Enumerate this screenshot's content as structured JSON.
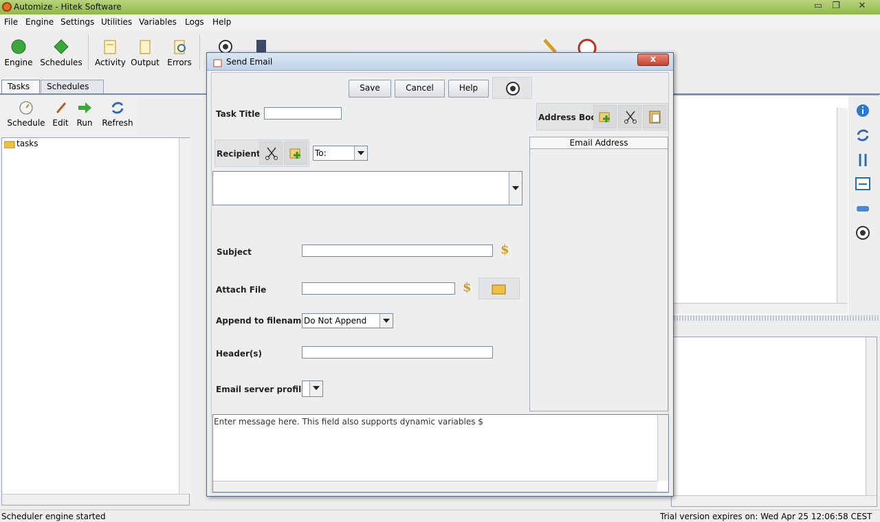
{
  "window": {
    "title": "Automize   - Hitek Software",
    "minimize": "▭",
    "restore": "❐",
    "close": "✕"
  },
  "menu": [
    "File",
    "Engine",
    "Settings",
    "Utilities",
    "Variables",
    "Logs",
    "Help"
  ],
  "toolbar": {
    "engine": "Engine",
    "schedules": "Schedules",
    "activity": "Activity",
    "output": "Output",
    "errors": "Errors"
  },
  "tabs": [
    "Tasks",
    "Schedules"
  ],
  "subtoolbar": {
    "schedule": "Schedule",
    "edit": "Edit",
    "run": "Run",
    "refresh": "Refresh"
  },
  "tree": {
    "root": "tasks"
  },
  "status": {
    "left": "Scheduler engine started",
    "right": "Trial version expires on: Wed Apr 25 12:06:58 CEST 2012"
  },
  "dialog": {
    "title": "Send Email",
    "close": "x",
    "buttons": {
      "save": "Save",
      "cancel": "Cancel",
      "help": "Help"
    },
    "task_title_label": "Task Title",
    "task_title_value": "",
    "address_book_label": "Address Book",
    "recipients_label": "Recipients",
    "recipient_type": "To:",
    "email_address_header": "Email Address",
    "subject_label": "Subject",
    "subject_value": "",
    "attach_label": "Attach File",
    "attach_value": "",
    "append_label": "Append to filename",
    "append_value": "Do Not Append",
    "headers_label": "Header(s)",
    "headers_value": "",
    "server_label": "Email server profile",
    "server_value": "",
    "message_placeholder": "Enter message here.  This field also supports dynamic variables $",
    "dollar": "$"
  }
}
